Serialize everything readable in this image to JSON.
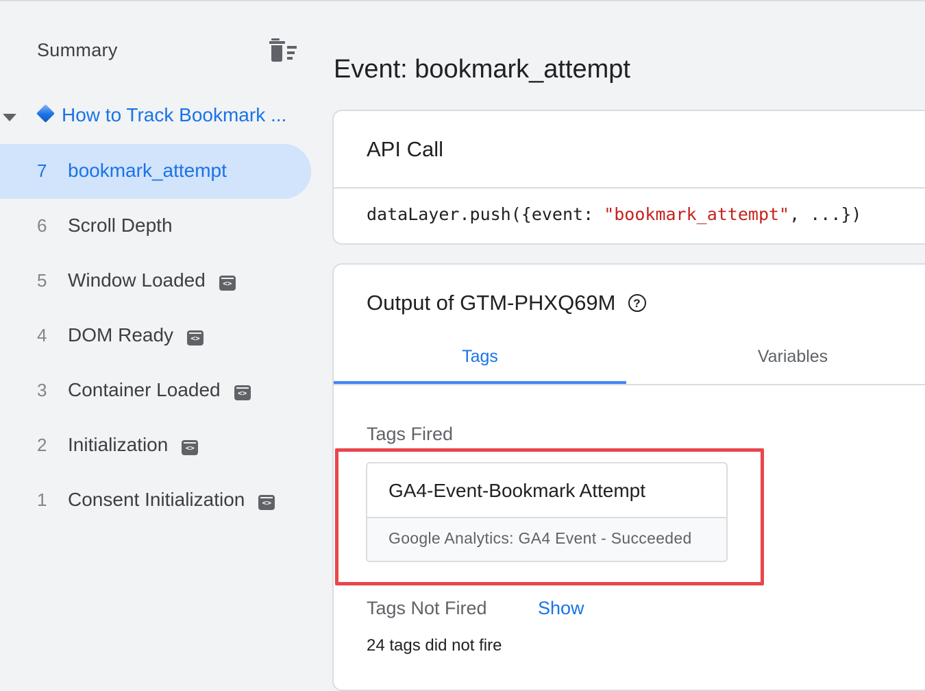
{
  "sidebar": {
    "summary_label": "Summary",
    "page_title": "How to Track Bookmark ...",
    "events": [
      {
        "num": "7",
        "label": "bookmark_attempt",
        "badge": false,
        "selected": true
      },
      {
        "num": "6",
        "label": "Scroll Depth",
        "badge": false,
        "selected": false
      },
      {
        "num": "5",
        "label": "Window Loaded",
        "badge": true,
        "selected": false
      },
      {
        "num": "4",
        "label": "DOM Ready",
        "badge": true,
        "selected": false
      },
      {
        "num": "3",
        "label": "Container Loaded",
        "badge": true,
        "selected": false
      },
      {
        "num": "2",
        "label": "Initialization",
        "badge": true,
        "selected": false
      },
      {
        "num": "1",
        "label": "Consent Initialization",
        "badge": true,
        "selected": false
      }
    ],
    "badge_text": "<>",
    "icons": {
      "clear": "clear-all-icon",
      "caret": "caret-down-icon",
      "page": "diamond-icon",
      "badge": "code-badge-icon"
    }
  },
  "main": {
    "title": "Event: bookmark_attempt",
    "api_call": {
      "heading": "API Call",
      "code_prefix": "dataLayer.push({event: ",
      "code_string": "\"bookmark_attempt\"",
      "code_suffix": ", ...})"
    },
    "output": {
      "heading": "Output of GTM-PHXQ69M",
      "help_glyph": "?",
      "tabs": [
        {
          "label": "Tags",
          "active": true
        },
        {
          "label": "Variables",
          "active": false
        }
      ],
      "tags_fired_label": "Tags Fired",
      "fired_tag": {
        "name": "GA4-Event-Bookmark Attempt",
        "status": "Google Analytics: GA4 Event - Succeeded"
      },
      "tags_not_fired_label": "Tags Not Fired",
      "show_label": "Show",
      "not_fired_count": "24 tags did not fire"
    }
  },
  "colors": {
    "accent": "#1a73e8",
    "selected_bg": "#d2e3fc",
    "highlight": "#e8464c",
    "string": "#c5221f"
  }
}
